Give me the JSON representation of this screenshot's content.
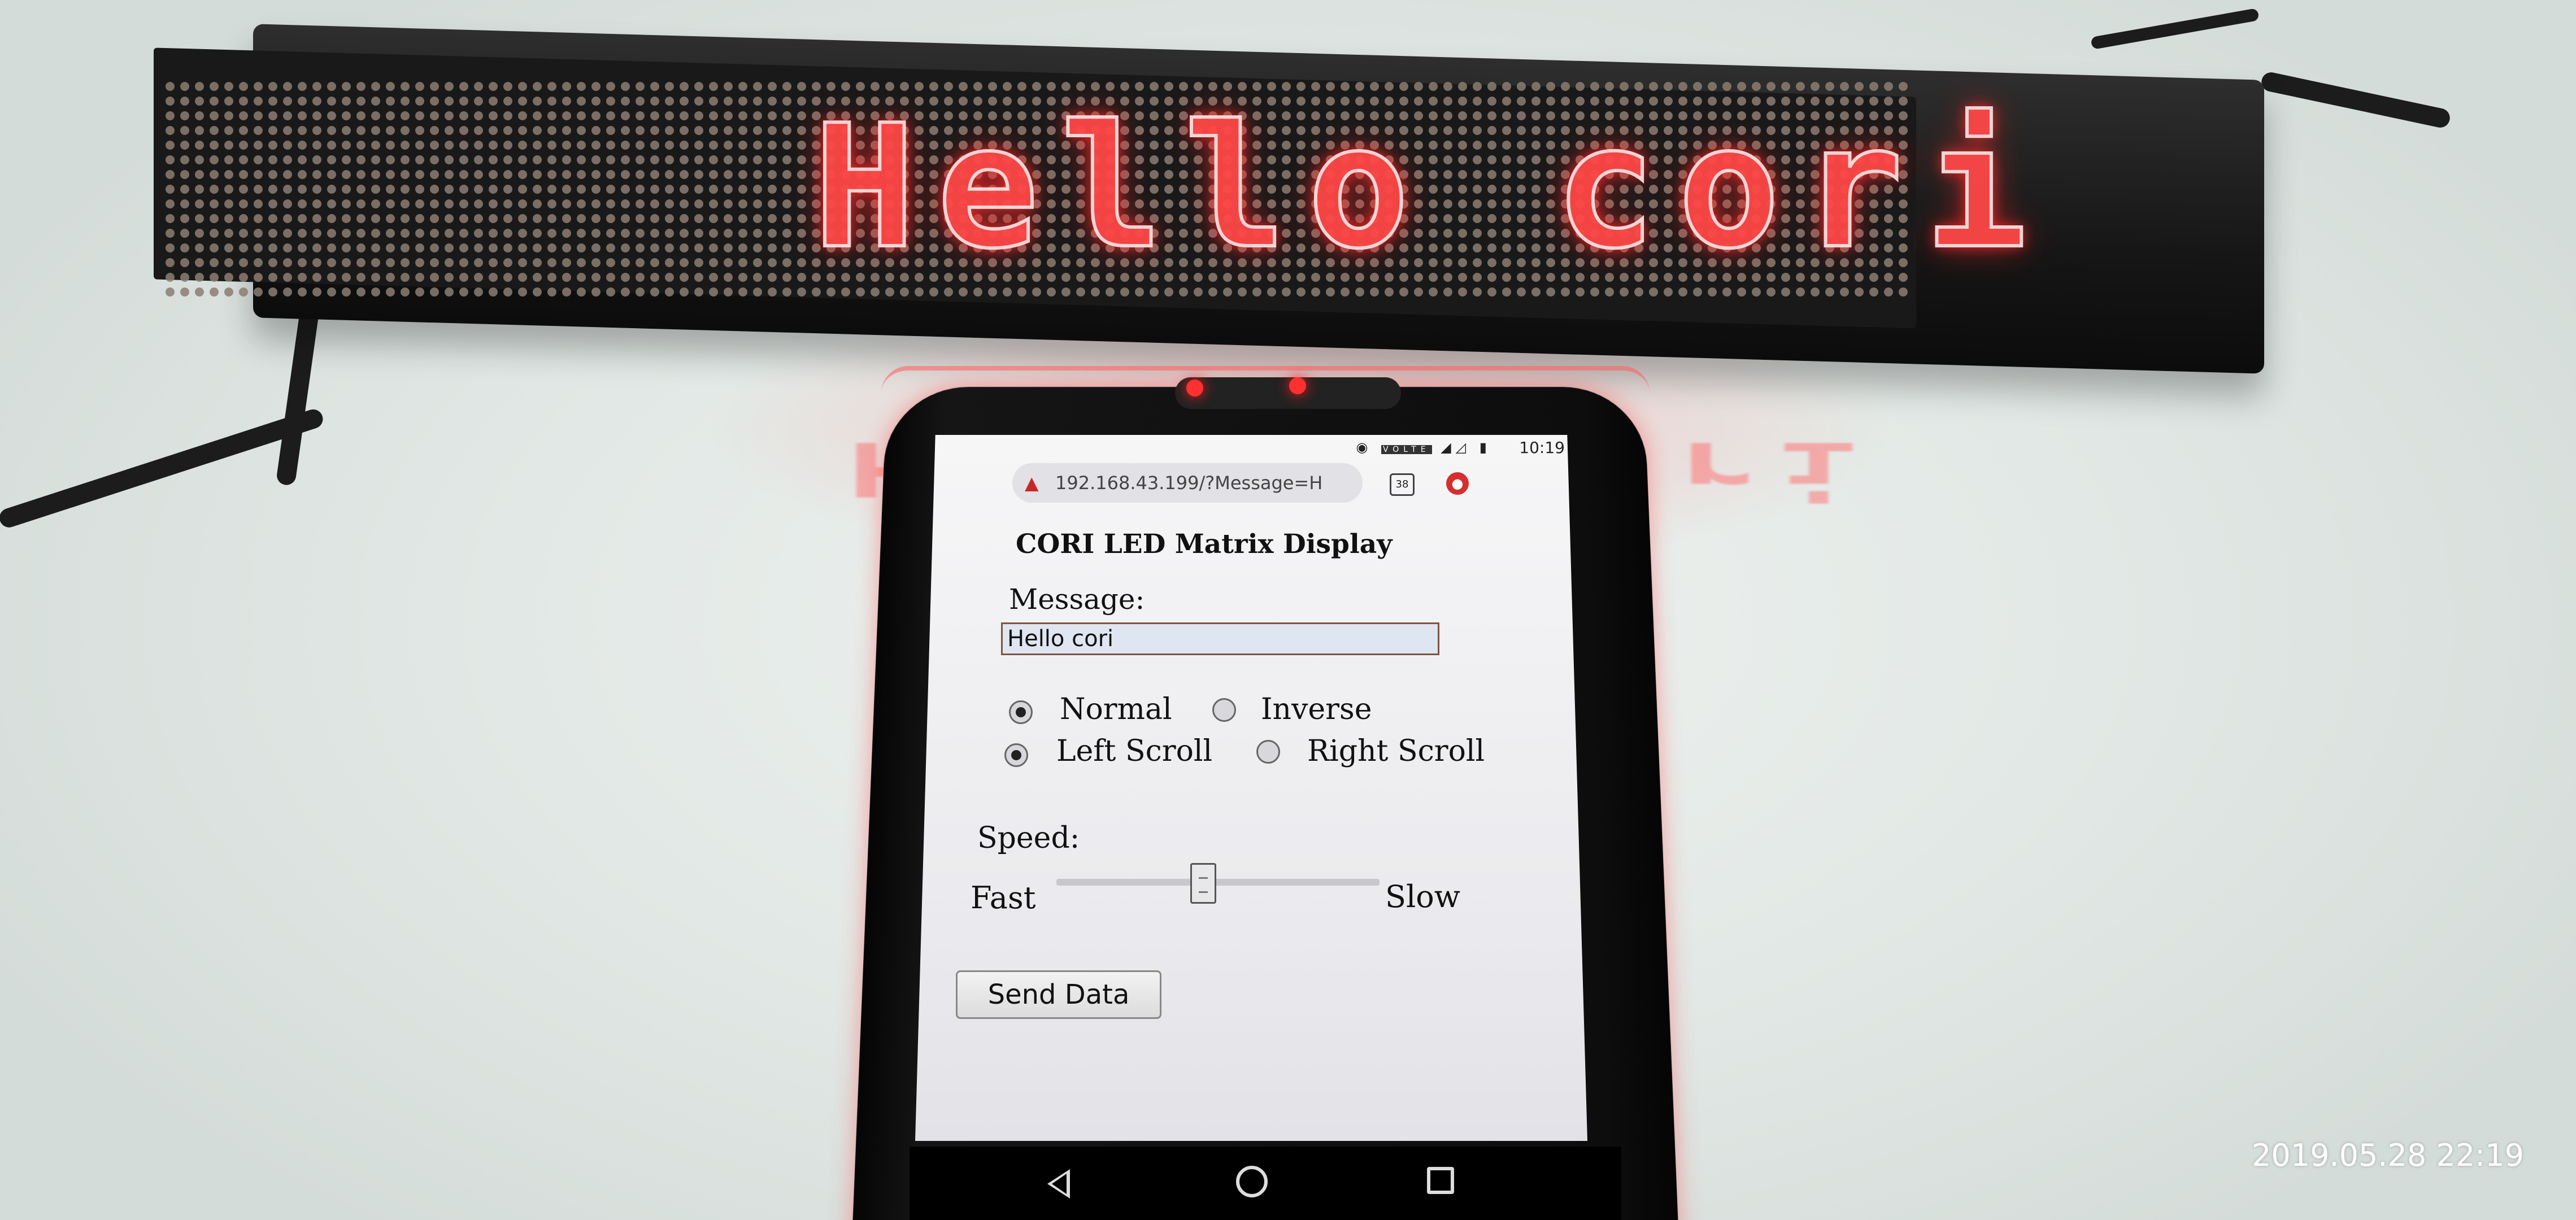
{
  "led_display": {
    "message": "Hello cori",
    "led_color": "#ff3b3b"
  },
  "phone": {
    "status_bar": {
      "time": "10:19",
      "icons": [
        "hotspot-icon",
        "volte-icon",
        "signal-icon",
        "battery-icon"
      ],
      "volte_label": "VOLTE"
    },
    "browser": {
      "url": "192.168.43.199/?Message=H",
      "tab_count": "38"
    },
    "page": {
      "title": "CORI LED Matrix Display",
      "message_label": "Message:",
      "message_value": "Hello cori",
      "mode_options": [
        {
          "label": "Normal",
          "selected": true
        },
        {
          "label": "Inverse",
          "selected": false
        }
      ],
      "scroll_options": [
        {
          "label": "Left Scroll",
          "selected": true
        },
        {
          "label": "Right Scroll",
          "selected": false
        }
      ],
      "speed_label": "Speed:",
      "speed_min_label": "Fast",
      "speed_max_label": "Slow",
      "speed_value_fraction": 0.45,
      "send_button": "Send Data"
    }
  },
  "photo_timestamp": "2019.05.28 22:19"
}
